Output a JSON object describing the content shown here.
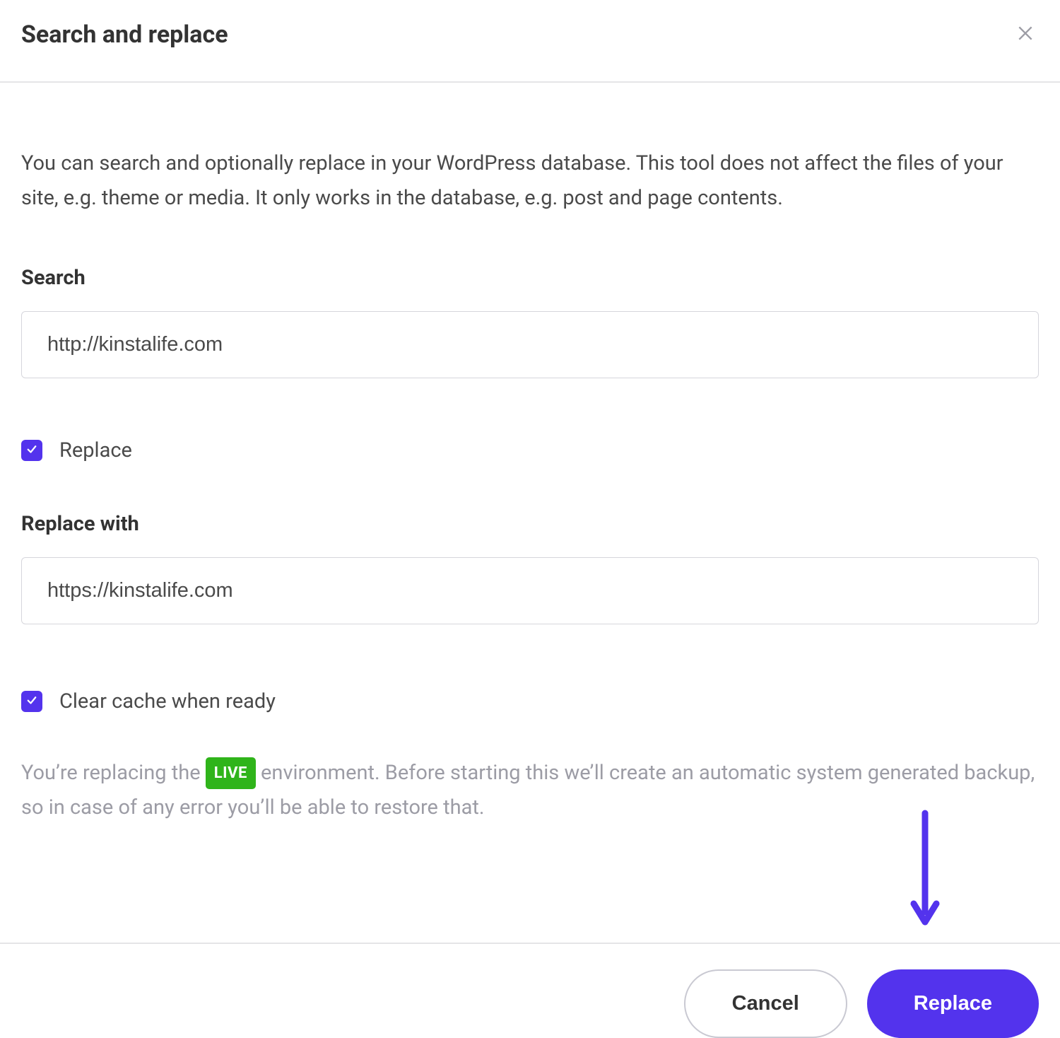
{
  "header": {
    "title": "Search and replace"
  },
  "body": {
    "intro": "You can search and optionally replace in your WordPress database. This tool does not affect the files of your site, e.g. theme or media. It only works in the database, e.g. post and page contents.",
    "search_label": "Search",
    "search_value": "http://kinstalife.com",
    "replace_checkbox_label": "Replace",
    "replace_with_label": "Replace with",
    "replace_with_value": "https://kinstalife.com",
    "clear_cache_label": "Clear cache when ready",
    "env_note_prefix": "You’re replacing the ",
    "env_badge": "LIVE",
    "env_note_suffix": " environment. Before starting this we’ll create an automatic system generated backup, so in case of any error you’ll be able to restore that."
  },
  "footer": {
    "cancel_label": "Cancel",
    "replace_label": "Replace"
  },
  "colors": {
    "accent": "#5333ed",
    "live_badge": "#2fb41a"
  }
}
